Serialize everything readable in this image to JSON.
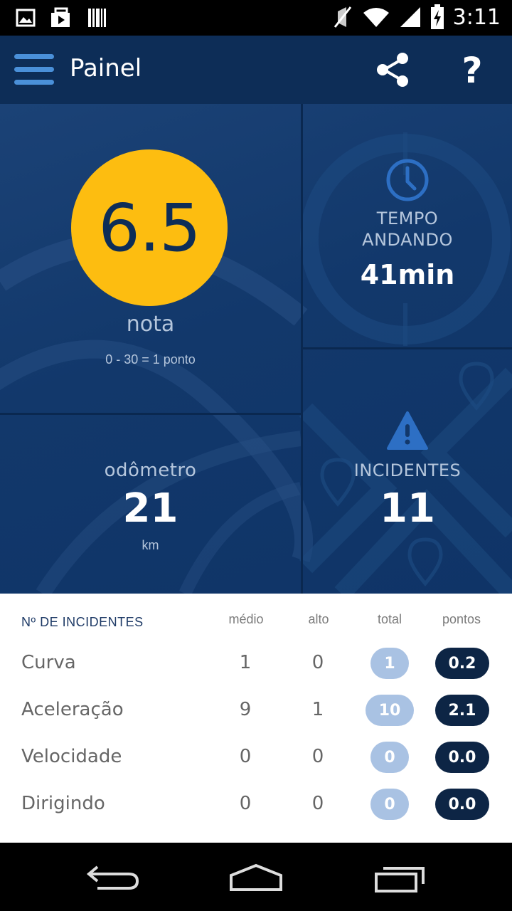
{
  "status_bar": {
    "time": "3:11",
    "icons": [
      "image-icon",
      "media-icon",
      "barcode-icon",
      "mute-icon",
      "wifi-icon",
      "signal-icon",
      "battery-charging-icon"
    ]
  },
  "app_bar": {
    "title": "Painel",
    "icons": [
      "menu-icon",
      "share-icon",
      "help-icon"
    ],
    "help_glyph": "?"
  },
  "dashboard": {
    "score": {
      "value": "6.5",
      "label": "nota",
      "scale": "0 - 30 = 1 ponto"
    },
    "time_tile": {
      "icon": "clock-icon",
      "label_line1": "TEMPO",
      "label_line2": "ANDANDO",
      "value": "41min"
    },
    "odometer_tile": {
      "label": "odômetro",
      "value": "21",
      "unit": "km"
    },
    "incidents_tile": {
      "icon": "warning-icon",
      "label": "INCIDENTES",
      "value": "11"
    }
  },
  "incidents_table": {
    "title": "Nº DE INCIDENTES",
    "columns": [
      "médio",
      "alto",
      "total",
      "pontos"
    ],
    "rows": [
      {
        "label": "Curva",
        "medio": "1",
        "alto": "0",
        "total": "1",
        "pontos": "0.2"
      },
      {
        "label": "Aceleração",
        "medio": "9",
        "alto": "1",
        "total": "10",
        "pontos": "2.1"
      },
      {
        "label": "Velocidade",
        "medio": "0",
        "alto": "0",
        "total": "0",
        "pontos": "0.0"
      },
      {
        "label": "Dirigindo",
        "medio": "0",
        "alto": "0",
        "total": "0",
        "pontos": "0.0"
      }
    ]
  },
  "nav_bar": {
    "icons": [
      "back-icon",
      "home-icon",
      "recents-icon"
    ]
  },
  "colors": {
    "app_bar": "#0d2d57",
    "accent": "#fdbd10",
    "menu_icon": "#4a90d9",
    "total_pill": "#a9c2e3",
    "points_pill": "#0d2545"
  }
}
